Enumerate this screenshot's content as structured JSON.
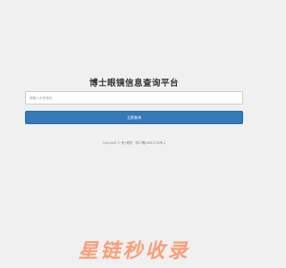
{
  "page": {
    "title": "博士眼镜信息查询平台"
  },
  "search": {
    "placeholder": "请输入手机号码",
    "value": ""
  },
  "actions": {
    "query_label": "立即查询"
  },
  "footer": {
    "copyright": "Copyright © 博士眼镜",
    "icp": "苏ICP备16012725号-1"
  },
  "watermark": {
    "text": "星链秒收录"
  },
  "colors": {
    "background": "#f0f0f0",
    "button": "#337ab7",
    "watermark": "#ff6a2a"
  }
}
